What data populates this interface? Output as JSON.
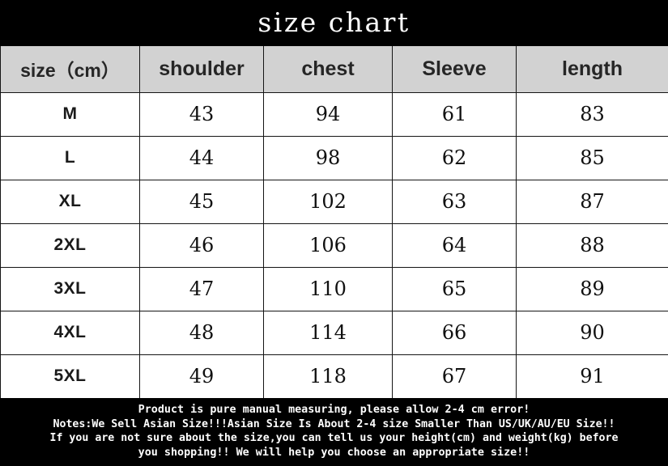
{
  "title": "size chart",
  "table": {
    "headers": [
      "size（cm）",
      "shoulder",
      "chest",
      "Sleeve",
      "length"
    ],
    "rows": [
      {
        "size": "M",
        "shoulder": "43",
        "chest": "94",
        "sleeve": "61",
        "length": "83"
      },
      {
        "size": "L",
        "shoulder": "44",
        "chest": "98",
        "sleeve": "62",
        "length": "85"
      },
      {
        "size": "XL",
        "shoulder": "45",
        "chest": "102",
        "sleeve": "63",
        "length": "87"
      },
      {
        "size": "2XL",
        "shoulder": "46",
        "chest": "106",
        "sleeve": "64",
        "length": "88"
      },
      {
        "size": "3XL",
        "shoulder": "47",
        "chest": "110",
        "sleeve": "65",
        "length": "89"
      },
      {
        "size": "4XL",
        "shoulder": "48",
        "chest": "114",
        "sleeve": "66",
        "length": "90"
      },
      {
        "size": "5XL",
        "shoulder": "49",
        "chest": "118",
        "sleeve": "67",
        "length": "91"
      }
    ]
  },
  "footer": {
    "lines": [
      "Product is pure manual measuring, please allow 2-4 cm error!",
      "Notes:We Sell Asian Size!!!Asian Size Is About 2-4 size Smaller Than US/UK/AU/EU Size!!",
      "If you are not sure about the size,you can tell us your height(cm) and weight(kg) before",
      "you shopping!! We will help you choose an appropriate size!!"
    ]
  },
  "colors": {
    "background": "#000000",
    "header_row": "#d2d2d2",
    "cell_background": "#ffffff",
    "title_text": "#ffffff",
    "body_text": "#101010",
    "border": "#151515"
  },
  "chart_data": {
    "type": "table",
    "title": "size chart",
    "columns": [
      "size（cm）",
      "shoulder",
      "chest",
      "Sleeve",
      "length"
    ],
    "categories": [
      "M",
      "L",
      "XL",
      "2XL",
      "3XL",
      "4XL",
      "5XL"
    ],
    "series": [
      {
        "name": "shoulder",
        "values": [
          43,
          44,
          45,
          46,
          47,
          48,
          49
        ]
      },
      {
        "name": "chest",
        "values": [
          94,
          98,
          102,
          106,
          110,
          114,
          118
        ]
      },
      {
        "name": "Sleeve",
        "values": [
          61,
          62,
          63,
          64,
          65,
          66,
          67
        ]
      },
      {
        "name": "length",
        "values": [
          83,
          85,
          87,
          88,
          89,
          90,
          91
        ]
      }
    ],
    "units": "cm",
    "notes": [
      "Product is pure manual measuring, please allow 2-4 cm error!",
      "Notes:We Sell Asian Size!!!Asian Size Is About 2-4 size Smaller Than US/UK/AU/EU Size!!",
      "If you are not sure about the size,you can tell us your height(cm) and weight(kg) before",
      "you shopping!! We will help you choose an appropriate size!!"
    ]
  }
}
